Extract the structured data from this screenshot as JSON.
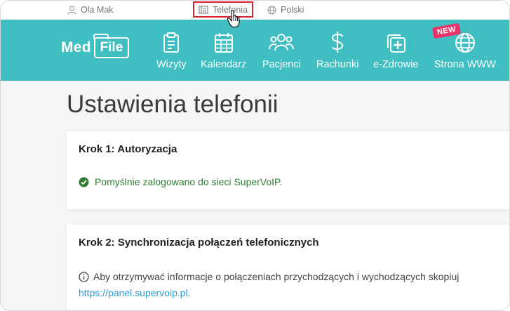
{
  "topbar": {
    "user": "Ola Mak",
    "telefonia": "Telefonia",
    "language": "Polski"
  },
  "logo": {
    "part1": "Med",
    "part2": "File"
  },
  "nav": {
    "items": [
      {
        "label": "Wizyty",
        "icon": "clipboard-icon"
      },
      {
        "label": "Kalendarz",
        "icon": "calendar-icon"
      },
      {
        "label": "Pacjenci",
        "icon": "users-icon"
      },
      {
        "label": "Rachunki",
        "icon": "dollar-icon"
      },
      {
        "label": "e-Zdrowie",
        "icon": "medical-cross-icon"
      },
      {
        "label": "Strona WWW",
        "icon": "globe-icon"
      }
    ],
    "badge": "NEW"
  },
  "page": {
    "title": "Ustawienia telefonii",
    "step1": {
      "heading": "Krok 1: Autoryzacja",
      "success": "Pomyślnie zalogowano do sieci SuperVoIP."
    },
    "step2": {
      "heading": "Krok 2: Synchronizacja połączeń telefonicznych",
      "info": "Aby otrzymywać informacje o połączeniach przychodzących i wychodzących skopiuj",
      "link": "https://panel.supervoip.pl."
    }
  },
  "colors": {
    "nav": "#3fbfc2",
    "badge": "#e8336b",
    "success": "#2e7d32",
    "link": "#2a9bd6"
  }
}
